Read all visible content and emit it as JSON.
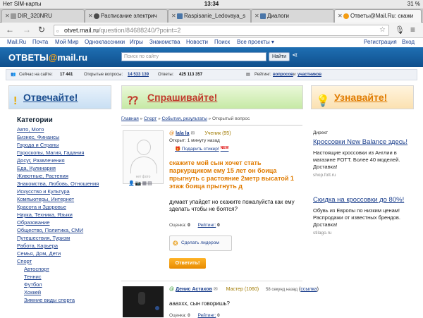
{
  "status": {
    "carrier": "Нет SIM-карты ",
    "time": "13:34",
    "battery": "31 %"
  },
  "tabs": [
    {
      "title": "DIR_320NRU"
    },
    {
      "title": "Расписание электрич"
    },
    {
      "title": "Raspisanie_Ledovaya_s"
    },
    {
      "title": "Диалоги"
    },
    {
      "title": "Ответы@Mail.Ru: скажи"
    }
  ],
  "address": {
    "host": "otvet.mail.ru",
    "path": "/question/84688240/?point=2"
  },
  "topnav": {
    "items": [
      "Mail.Ru",
      "Почта",
      "Мой Мир",
      "Одноклассники",
      "Игры",
      "Знакомства",
      "Новости",
      "Поиск",
      "Все проекты ▾"
    ],
    "right": [
      "Регистрация",
      "Вход"
    ]
  },
  "header": {
    "logo_left": "ОТВЕТЫ",
    "logo_at": "@",
    "logo_right": "mail.ru",
    "search_placeholder": "Поиск по сайту",
    "search_button": "Найти"
  },
  "stats": {
    "online_label": "Сейчас на сайте:",
    "online_value": "17 441",
    "open_label": "Открытые вопросы:",
    "open_value": "14 533 139",
    "answers_label": "Ответы:",
    "answers_value": "425 113 357",
    "rating_label": "Рейтинг:",
    "rating_link1": "вопросов",
    "rating_and": "и",
    "rating_link2": "участников"
  },
  "banners": {
    "answer": "Отвечайте!",
    "ask": "Спрашивайте!",
    "learn": "Узнавайте!"
  },
  "categories": {
    "heading": "Категории",
    "items": [
      {
        "label": "Авто, Мото",
        "sub": false
      },
      {
        "label": "Бизнес, Финансы",
        "sub": false
      },
      {
        "label": "Города и Страны",
        "sub": false
      },
      {
        "label": "Гороскопы, Магия, Гадания",
        "sub": false
      },
      {
        "label": "Досуг, Развлечения",
        "sub": false
      },
      {
        "label": "Еда, Кулинария",
        "sub": false
      },
      {
        "label": "Животные, Растения",
        "sub": false
      },
      {
        "label": "Знакомства, Любовь, Отношения",
        "sub": false
      },
      {
        "label": "Искусство и Культура",
        "sub": false
      },
      {
        "label": "Компьютеры, Интернет",
        "sub": false
      },
      {
        "label": "Красота и Здоровье",
        "sub": false
      },
      {
        "label": "Наука, Техника, Языки",
        "sub": false
      },
      {
        "label": "Образование",
        "sub": false
      },
      {
        "label": "Общество, Политика, СМИ",
        "sub": false
      },
      {
        "label": "Путешествия, Туризм",
        "sub": false
      },
      {
        "label": "Работа, Карьера",
        "sub": false
      },
      {
        "label": "Семья, Дом, Дети",
        "sub": false
      },
      {
        "label": "Спорт",
        "sub": false
      },
      {
        "label": "Автоспорт",
        "sub": true
      },
      {
        "label": "Теннис",
        "sub": true
      },
      {
        "label": "Футбол",
        "sub": true
      },
      {
        "label": "Хоккей",
        "sub": true
      },
      {
        "label": "Зимние виды спорта",
        "sub": true
      }
    ]
  },
  "breadcrumb": {
    "home": "Главная",
    "sport": "Спорт",
    "events": "События, результаты",
    "current": "Открытый вопрос",
    "sep": " » "
  },
  "question": {
    "author": "lala la",
    "rank": "Ученик (95)",
    "time": "Открыт: 1 минуту назад",
    "gift": "Подарить стикер!",
    "gift_new": "NEW",
    "avatar_caption": "нет фото",
    "title": "скажите мой сын хочет стать паркурщиком ему 15 лет он боица прыгнуть с растояние 2метр высатой 1 этаж боица прыгнуть д",
    "body": "думает упайдет но скажите пожалуйста как ему зделать чтобы не боятся?",
    "rating_label": "Оценка:",
    "rating_value": "0",
    "rank_label": "Рейтинг:",
    "rank_value": "0",
    "leader_button": "Сделать лидером",
    "answer_button": "Ответить!"
  },
  "answer": {
    "author": "Денис Астахов",
    "rank": "Мастер (1060)",
    "time": "58 секунд назад",
    "link_open": "(",
    "link": "ссылка",
    "link_close": ")",
    "body": "аааххх, сын говоришь?",
    "rating_label": "Оценка:",
    "rating_value": "0",
    "rank_label": "Рейтинг:",
    "rank_value": "0"
  },
  "ads": {
    "label": "Директ",
    "items": [
      {
        "title": "Кроссовки New Balance здесь!",
        "desc": "Настоящие кроссовки из Англии в магазине FOTT. Более 40 моделей. Доставка!",
        "url": "shop.fott.ru"
      },
      {
        "title": "Скидка на кроссовки до 80%!",
        "desc": "Обувь из Европы по низким ценам! Распродажи от известных брендов. Доставка!",
        "url": "stilago.ru"
      }
    ]
  },
  "colors": {
    "header_blue": "#145a9c",
    "link_blue": "#1a3e8c",
    "orange": "#e07b00",
    "red": "#c0392b"
  }
}
